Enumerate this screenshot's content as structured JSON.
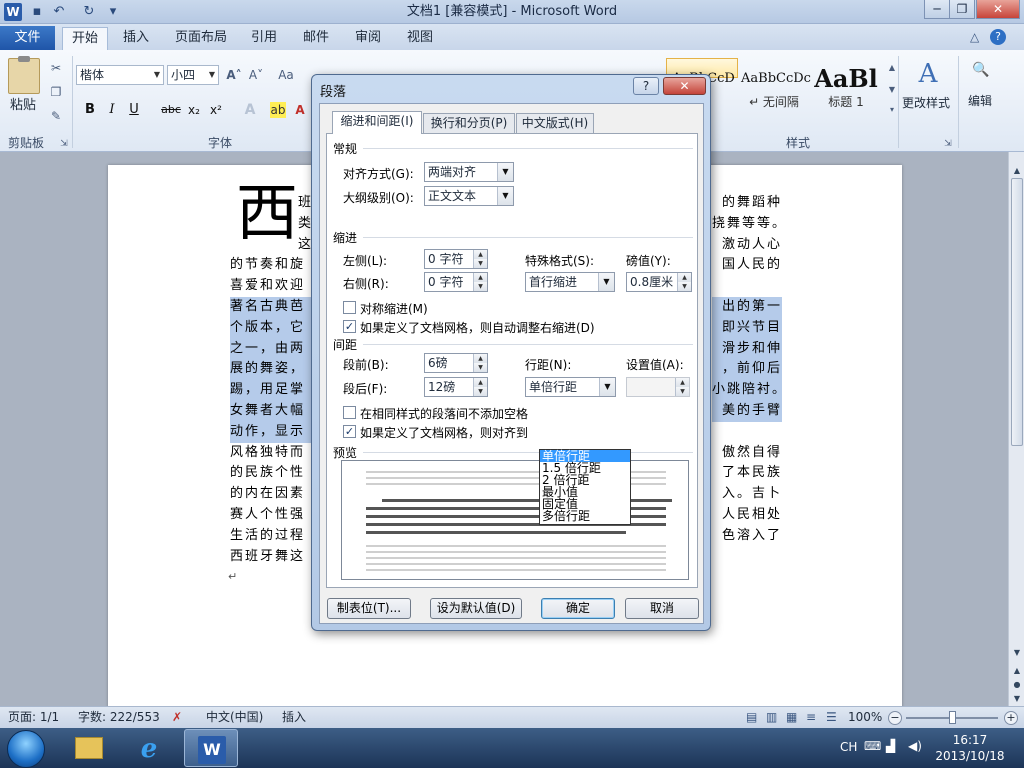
{
  "window": {
    "title": "文档1 [兼容模式] - Microsoft Word",
    "app_icon": "W",
    "quick_access": [
      "save-icon",
      "undo-icon",
      "redo-icon",
      "customize-icon"
    ],
    "controls": {
      "minimize": "─",
      "restore": "❐",
      "close": "✕"
    }
  },
  "ribbon": {
    "file_tab": "文件",
    "tabs": [
      "开始",
      "插入",
      "页面布局",
      "引用",
      "邮件",
      "审阅",
      "视图"
    ],
    "active_tab": "开始",
    "clipboard": {
      "paste": "粘贴",
      "label": "剪贴板"
    },
    "font": {
      "name": "楷体",
      "size": "小四",
      "label": "字体",
      "buttons": [
        "B",
        "I",
        "U",
        "abc",
        "x₂",
        "x²",
        "A"
      ]
    },
    "styles": {
      "label": "样式",
      "items": [
        {
          "sample": "AaBbCcD",
          "name": ""
        },
        {
          "sample": "AaBbCcDc",
          "name": "↵ 无间隔"
        },
        {
          "sample": "AaBl",
          "name": "标题 1"
        }
      ],
      "change_styles": "更改样式"
    },
    "editing": {
      "label": "编辑"
    }
  },
  "document": {
    "dropcap": "西",
    "lines": [
      {
        "text": "班",
        "right": "的舞蹈种",
        "hl": false
      },
      {
        "text": "类",
        "right": "挠舞等等。",
        "hl": false
      },
      {
        "text": "这",
        "right": "激动人心",
        "hl": false
      },
      {
        "text": "的节奏和旋",
        "right": "国人民的",
        "hl": false
      },
      {
        "text": "喜爱和欢迎",
        "right": "",
        "hl": false
      },
      {
        "text": "著名古典芭",
        "right": "出的第一",
        "hl": true
      },
      {
        "text": "个版本，它",
        "right": "即兴节目",
        "hl": true
      },
      {
        "text": "之一，由两",
        "right": "滑步和伸",
        "hl": true
      },
      {
        "text": "展的舞姿，",
        "right": "，前仰后",
        "hl": true
      },
      {
        "text": "踢，用足掌",
        "right": "小跳陪衬。",
        "hl": true
      },
      {
        "text": "女舞者大幅",
        "right": "美的手臂",
        "hl": true
      },
      {
        "text": "动作，显示",
        "right": "",
        "hl": true
      },
      {
        "text": "风格独特而",
        "right": "傲然自得",
        "hl": false
      },
      {
        "text": "的民族个性",
        "right": "了本民族",
        "hl": false
      },
      {
        "text": "的内在因素",
        "right": "入。吉卜",
        "hl": false
      },
      {
        "text": "赛人个性强",
        "right": "人民相处",
        "hl": false
      },
      {
        "text": "生活的过程",
        "right": "色溶入了",
        "hl": false
      },
      {
        "text": "西班牙舞这",
        "right": "",
        "hl": false
      }
    ],
    "para_mark": "↵"
  },
  "statusbar": {
    "page": "页面: 1/1",
    "words": "字数: 222/553",
    "language": "中文(中国)",
    "mode": "插入",
    "zoom": "100%",
    "zoom_level": 1.0
  },
  "taskbar": {
    "tray_lang": "CH",
    "time": "16:17",
    "date": "2013/10/18"
  },
  "dialog": {
    "title": "段落",
    "help": "?",
    "close": "✕",
    "tabs": [
      "缩进和间距(I)",
      "换行和分页(P)",
      "中文版式(H)"
    ],
    "active_tab": 0,
    "general": {
      "section": "常规",
      "alignment_label": "对齐方式(G):",
      "alignment_value": "两端对齐",
      "outline_label": "大纲级别(O):",
      "outline_value": "正文文本"
    },
    "indent": {
      "section": "缩进",
      "left_label": "左侧(L):",
      "left_value": "0 字符",
      "right_label": "右侧(R):",
      "right_value": "0 字符",
      "special_label": "特殊格式(S):",
      "special_value": "首行缩进",
      "by_label": "磅值(Y):",
      "by_value": "0.8厘米",
      "mirror": "对称缩进(M)",
      "mirror_checked": false,
      "auto_adjust": "如果定义了文档网格，则自动调整右缩进(D)",
      "auto_adjust_checked": true
    },
    "spacing": {
      "section": "间距",
      "before_label": "段前(B):",
      "before_value": "6磅",
      "after_label": "段后(F):",
      "after_value": "12磅",
      "line_label": "行距(N):",
      "line_value": "单倍行距",
      "at_label": "设置值(A):",
      "at_value": "",
      "no_space": "在相同样式的段落间不添加空格",
      "no_space_checked": false,
      "snap_grid": "如果定义了文档网格，则对齐到",
      "snap_grid_checked": true,
      "line_options": [
        "单倍行距",
        "1.5 倍行距",
        "2 倍行距",
        "最小值",
        "固定值",
        "多倍行距"
      ]
    },
    "preview": {
      "section": "预览"
    },
    "buttons": {
      "tabs": "制表位(T)...",
      "default": "设为默认值(D)",
      "ok": "确定",
      "cancel": "取消"
    }
  }
}
